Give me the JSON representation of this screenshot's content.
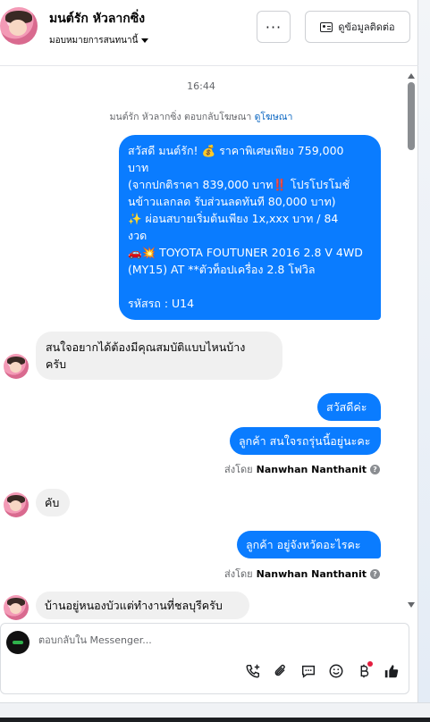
{
  "header": {
    "contact_name": "มนต์รัก หัวลากซิ่ง",
    "assign_label": "มอบหมายการสนทนานี้",
    "more_label": "···",
    "contact_info_label": "ดูข้อมูลติดต่อ"
  },
  "thread": {
    "timestamp": "16:44",
    "ad_note_prefix": "มนต์รัก หัวลากซิ่ง ตอบกลับโฆษณา",
    "ad_link": "ดูโฆษณา",
    "messages": [
      {
        "direction": "outgoing",
        "lines": [
          "สวัสดี มนต์รัก! 💰 ราคาพิเศษเพียง 759,000",
          "บาท",
          "(จากปกติราคา 839,000 บาท‼️ โปรโปรโมชั่",
          "นข้าวแลกลด รับส่วนลดทันที 80,000 บาท)",
          "✨ ผ่อนสบายเริ่มต้นเพียง 1x,xxx บาท / 84",
          "งวด",
          "🚗💥 TOYOTA FOUTUNER 2016 2.8 V 4WD",
          "(MY15) AT **ตัวท็อปเครื่อง 2.8 โฟวิล",
          "",
          "รหัสรถ : U14"
        ]
      },
      {
        "direction": "incoming",
        "lines": [
          "สนใจอยากได้ต้องมีคุณสมบัติแบบไหนบ้าง",
          "ครับ"
        ]
      },
      {
        "direction": "outgoing",
        "text": "สวัสดีค่ะ"
      },
      {
        "direction": "outgoing",
        "text": "ลูกค้า สนใจรถรุ่นนี้อยู่นะคะ"
      },
      {
        "direction": "incoming",
        "text": "คับ"
      },
      {
        "direction": "outgoing",
        "text": "ลูกค้า อยู่จังหวัดอะไรคะ"
      },
      {
        "direction": "incoming",
        "text": "บ้านอยู่หนองบัวแต่ทำงานที่ชลบุรีครับ"
      }
    ],
    "sent_by_prefix": "ส่งโดย",
    "sent_by_name": "Nanwhan Nanthanit",
    "info_glyph": "?"
  },
  "composer": {
    "placeholder": "ตอบกลับใน Messenger...",
    "tools": [
      "phone-plus-icon",
      "attachment-icon",
      "saved-reply-icon",
      "emoji-icon",
      "payment-icon",
      "thumbs-up-icon"
    ]
  },
  "colors": {
    "outgoing_bubble": "#0a7cff",
    "incoming_bubble": "#f0f0f0",
    "link": "#0a66c2",
    "notification_dot": "#e41e3f"
  }
}
